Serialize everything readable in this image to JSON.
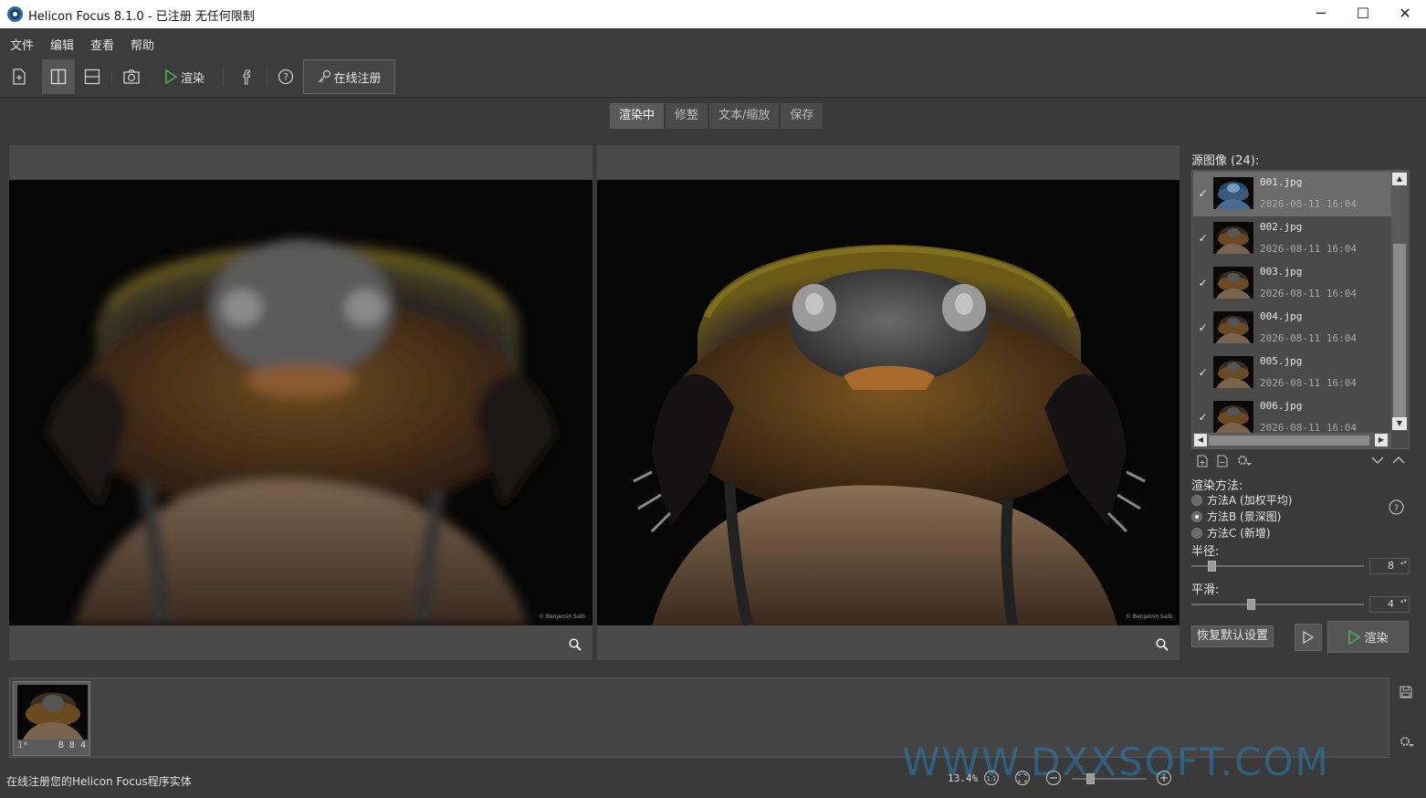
{
  "app": {
    "title": "Helicon Focus 8.1.0 - 已注册  无任何限制",
    "minimize": "─",
    "maximize": "☐",
    "close": "✕"
  },
  "menu": [
    "文件",
    "编辑",
    "查看",
    "帮助"
  ],
  "toolbar": {
    "render_label": "渲染",
    "register_label": "在线注册"
  },
  "tabs": [
    {
      "label": "渲染中",
      "selected": true
    },
    {
      "label": "修整"
    },
    {
      "label": "文本/缩放"
    },
    {
      "label": "保存"
    }
  ],
  "preview": {
    "watermark_left": "© Benjamin Salb",
    "watermark_right": "© Benjamin Salb"
  },
  "sources": {
    "label": "源图像 (24):",
    "items": [
      {
        "name": "001.jpg",
        "date": "2026-08-11 16:04",
        "checked": true,
        "selected": true
      },
      {
        "name": "002.jpg",
        "date": "2026-08-11 16:04",
        "checked": true
      },
      {
        "name": "003.jpg",
        "date": "2026-08-11 16:04",
        "checked": true
      },
      {
        "name": "004.jpg",
        "date": "2026-08-11 16:04",
        "checked": true
      },
      {
        "name": "005.jpg",
        "date": "2026-08-11 16:04",
        "checked": true
      },
      {
        "name": "006.jpg",
        "date": "2026-08-11 16:04",
        "checked": true
      }
    ]
  },
  "render": {
    "method_label": "渲染方法:",
    "methods": [
      {
        "label": "方法A (加权平均)",
        "selected": false
      },
      {
        "label": "方法B (景深图)",
        "selected": true
      },
      {
        "label": "方法C (新增)",
        "selected": false
      }
    ],
    "radius_label": "半径:",
    "radius_value": "8",
    "radius_fraction": 0.1,
    "smooth_label": "平滑:",
    "smooth_value": "4",
    "smooth_fraction": 0.34,
    "reset_label": "恢复默认设置",
    "render_label": "渲染"
  },
  "filmstrip": {
    "thumb_index": "1*",
    "thumb_meta": "B 8 4"
  },
  "status": {
    "message": "在线注册您的Helicon Focus程序实体",
    "zoom": "13.4%",
    "watermark": "WWW.DXXSOFT.COM"
  },
  "colors": {
    "accent_green": "#4caf50",
    "panel": "#4a4a4a",
    "background": "#3a3a3a"
  }
}
